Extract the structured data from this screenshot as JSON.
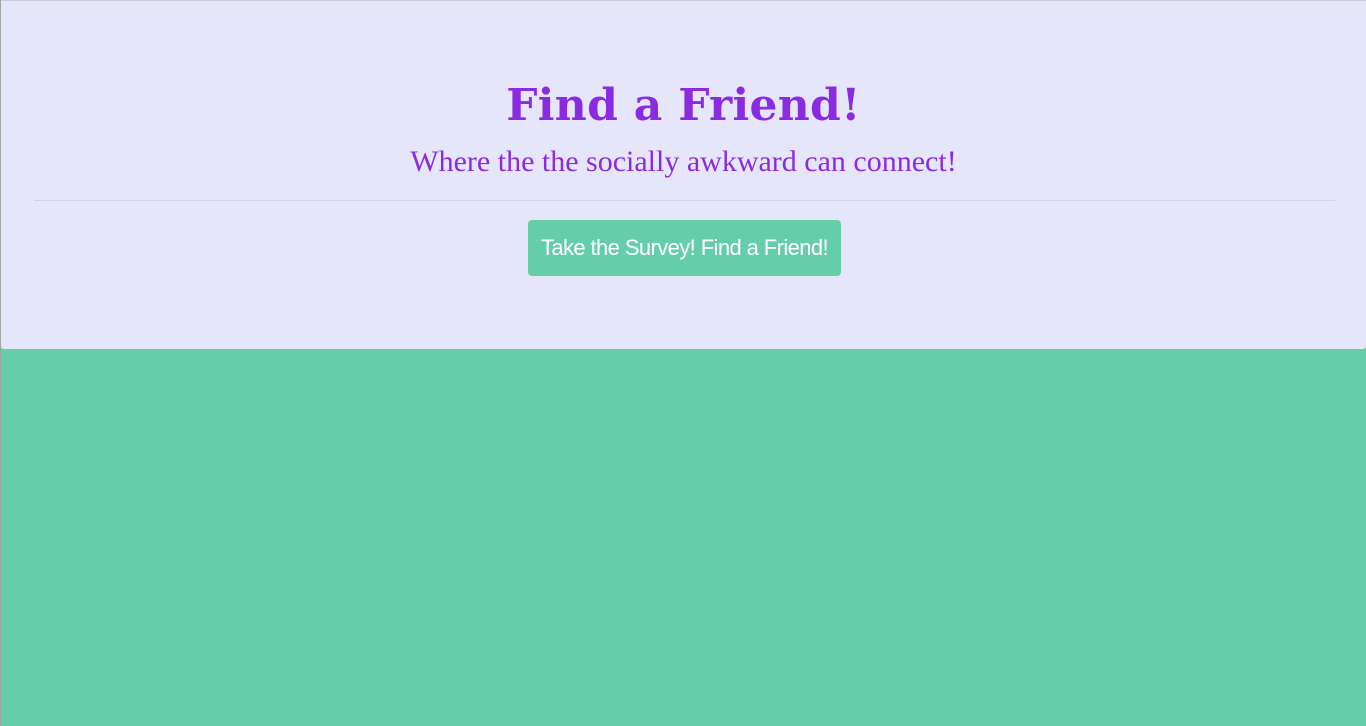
{
  "header": {
    "title": "Find a Friend!",
    "subtitle": "Where the the socially awkward can connect!"
  },
  "actions": {
    "survey_button_label": "Take the Survey! Find a Friend!"
  },
  "colors": {
    "background": "#66cdaa",
    "jumbotron_background": "#e6e6fa",
    "heading_text": "#8a2be2",
    "button_background": "#66cdaa",
    "button_text": "#ffffff"
  }
}
